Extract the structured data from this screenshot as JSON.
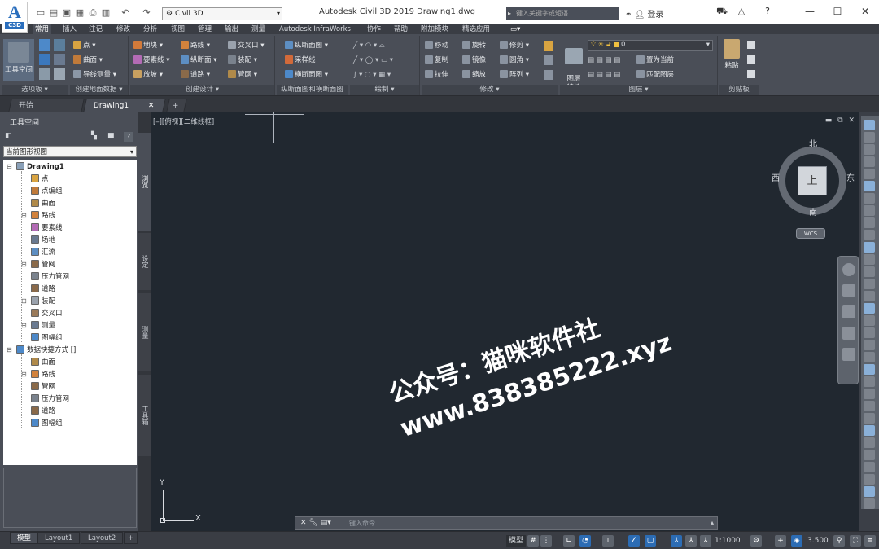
{
  "logo": {
    "big": "A",
    "small": "C3D"
  },
  "workspace": "Civil 3D",
  "app_title": "Autodesk Civil 3D 2019",
  "doc_title": "Drawing1.dwg",
  "search_placeholder": "键入关键字或短语",
  "login": "登录",
  "ribbon_tabs": [
    "常用",
    "插入",
    "注记",
    "修改",
    "分析",
    "视图",
    "管理",
    "输出",
    "测量",
    "Autodesk InfraWorks",
    "协作",
    "帮助",
    "附加模块",
    "精选应用"
  ],
  "ribbon": {
    "toolspace_label": "工具空间",
    "panel_titles": [
      "选项板 ▾",
      "创建地面数据 ▾",
      "创建设计 ▾",
      "纵断面图和横断面图",
      "绘制 ▾",
      "修改 ▾",
      "图层 ▾",
      "剪贴板"
    ],
    "ground_items": [
      "点 ▾",
      "曲面 ▾",
      "导线测量 ▾"
    ],
    "design_items": [
      "地块 ▾",
      "要素线 ▾",
      "放坡 ▾",
      "路线 ▾",
      "纵断面 ▾",
      "道路 ▾",
      "交叉口 ▾",
      "装配 ▾",
      "管网 ▾"
    ],
    "section_items": [
      "纵断面图 ▾",
      "采样线",
      "横断面图 ▾"
    ],
    "modify_items": [
      "移动",
      "旋转",
      "修剪 ▾",
      "复制",
      "镜像",
      "圆角 ▾",
      "拉伸",
      "缩放",
      "阵列 ▾"
    ],
    "layer_props": "图层\n特性",
    "layer_value": "0",
    "layer_actions": [
      "置为当前",
      "匹配图层"
    ],
    "paste": "粘贴"
  },
  "doc_tabs": [
    "开始",
    "Drawing1"
  ],
  "toolspace": {
    "title": "工具空间",
    "view": "当前图形视图",
    "tree": [
      {
        "label": "Drawing1",
        "bold": true
      },
      {
        "label": "点"
      },
      {
        "label": "点编组"
      },
      {
        "label": "曲面"
      },
      {
        "label": "路线"
      },
      {
        "label": "要素线"
      },
      {
        "label": "场地"
      },
      {
        "label": "汇流"
      },
      {
        "label": "管网"
      },
      {
        "label": "压力管网"
      },
      {
        "label": "道路"
      },
      {
        "label": "装配"
      },
      {
        "label": "交叉口"
      },
      {
        "label": "测量"
      },
      {
        "label": "图幅组"
      },
      {
        "label": "数据快捷方式 []",
        "bold": false
      },
      {
        "label": "曲面"
      },
      {
        "label": "路线"
      },
      {
        "label": "管网"
      },
      {
        "label": "压力管网"
      },
      {
        "label": "道路"
      },
      {
        "label": "图幅组"
      }
    ],
    "side_tabs": [
      "浏览",
      "设定",
      "测量",
      "工具箱"
    ]
  },
  "viewport": {
    "label": "[–][俯视][二维线框]",
    "viewcube": {
      "north": "北",
      "south": "南",
      "east": "东",
      "west": "西",
      "face": "上"
    },
    "wcs": "WCS",
    "ucs_x": "X",
    "ucs_y": "Y",
    "watermark_line1": "公众号：猫咪软件社",
    "watermark_line2": "www.838385222.xyz"
  },
  "command": {
    "placeholder": "键入命令"
  },
  "layout_tabs": [
    "模型",
    "Layout1",
    "Layout2"
  ],
  "status": {
    "model": "模型",
    "scale": "1:1000",
    "value": "3.500"
  }
}
